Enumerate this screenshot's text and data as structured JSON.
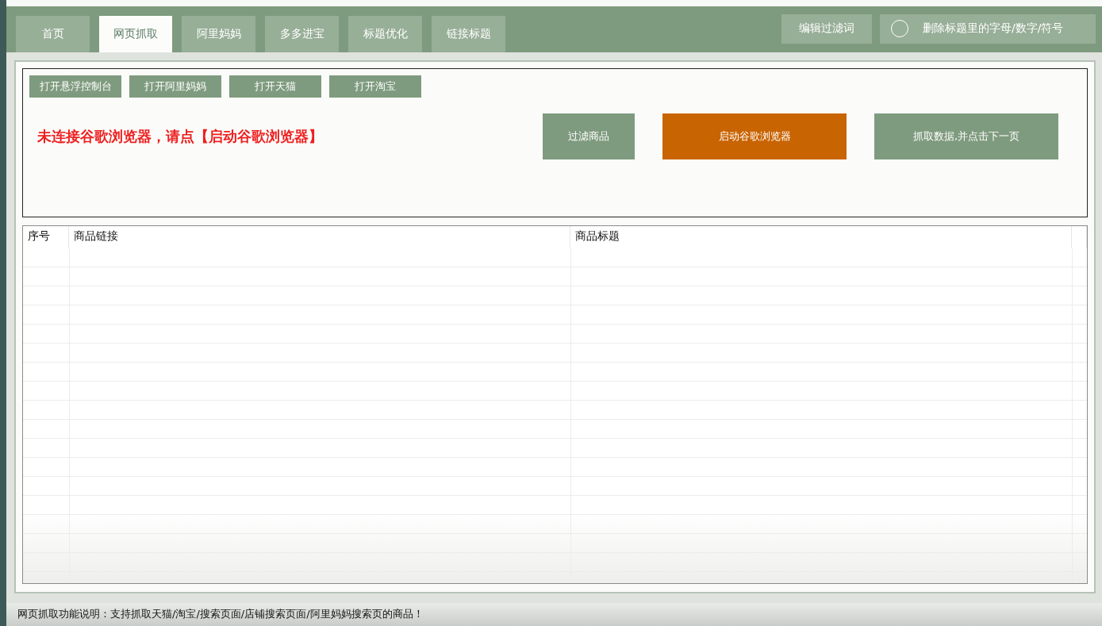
{
  "tabs": [
    {
      "label": "首页",
      "selected": false
    },
    {
      "label": "网页抓取",
      "selected": true
    },
    {
      "label": "阿里妈妈",
      "selected": false
    },
    {
      "label": "多多进宝",
      "selected": false
    },
    {
      "label": "标题优化",
      "selected": false
    },
    {
      "label": "链接标题",
      "selected": false
    }
  ],
  "header_actions": {
    "edit_button": "编辑过滤词",
    "option": {
      "label": "删除标题里的字母/数字/符号",
      "checked": false
    }
  },
  "open_buttons": [
    "打开悬浮控制台",
    "打开阿里妈妈",
    "打开天猫",
    "打开淘宝"
  ],
  "status_message": "未连接谷歌浏览器，请点【启动谷歌浏览器】",
  "actions": [
    {
      "label": "过滤商品",
      "kind": "normal"
    },
    {
      "label": "启动谷歌浏览器",
      "kind": "primary"
    },
    {
      "label": "抓取数据,并点击下一页",
      "kind": "normal"
    }
  ],
  "table": {
    "columns": [
      "序号",
      "商品链接",
      "商品标题"
    ]
  },
  "status_bar": "网页抓取功能说明：支持抓取天猫/淘宝/搜索页面/店铺搜索页面/阿里妈妈搜索页的商品！"
}
